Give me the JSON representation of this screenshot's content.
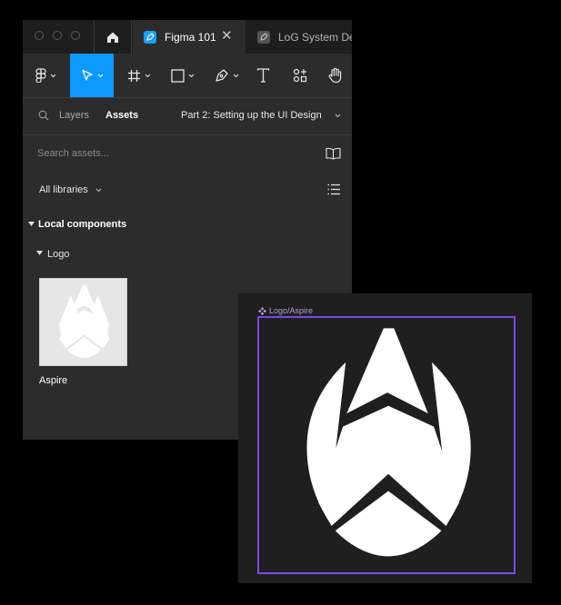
{
  "tabs": [
    {
      "label": "Figma 101",
      "active": true
    },
    {
      "label": "LoG System De",
      "active": false
    }
  ],
  "toolbar": {
    "tools": [
      "figma-menu",
      "move",
      "frame",
      "shape",
      "pen",
      "text",
      "resources",
      "hand"
    ],
    "active_tool": "move",
    "accent": "#0d99ff"
  },
  "panel": {
    "layers_tab": "Layers",
    "assets_tab": "Assets",
    "page_name": "Part 2: Setting up the UI Design"
  },
  "search": {
    "placeholder": "Search assets..."
  },
  "libraries": {
    "label": "All libraries"
  },
  "local": {
    "title": "Local components",
    "group": "Logo",
    "components": [
      {
        "name": "Aspire"
      }
    ]
  },
  "canvas": {
    "frame_label": "Logo/Aspire",
    "frame_color": "#7b48e8"
  }
}
